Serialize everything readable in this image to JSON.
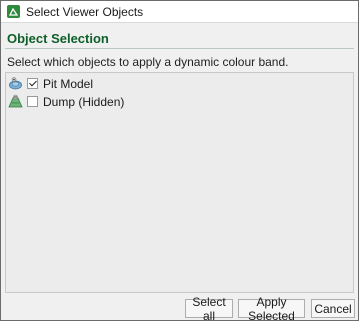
{
  "window": {
    "title": "Select Viewer Objects"
  },
  "section": {
    "heading": "Object Selection",
    "description": "Select which objects to apply a dynamic colour band."
  },
  "objects": [
    {
      "label": "Pit Model",
      "checked": true,
      "icon": "pit-model-icon"
    },
    {
      "label": "Dump (Hidden)",
      "checked": false,
      "icon": "dump-hidden-icon"
    }
  ],
  "buttons": {
    "select_all": "Select all",
    "apply_selected": "Apply Selected",
    "cancel": "Cancel"
  },
  "colors": {
    "heading": "#0e5f2a",
    "app_icon": "#2f8a3b"
  }
}
